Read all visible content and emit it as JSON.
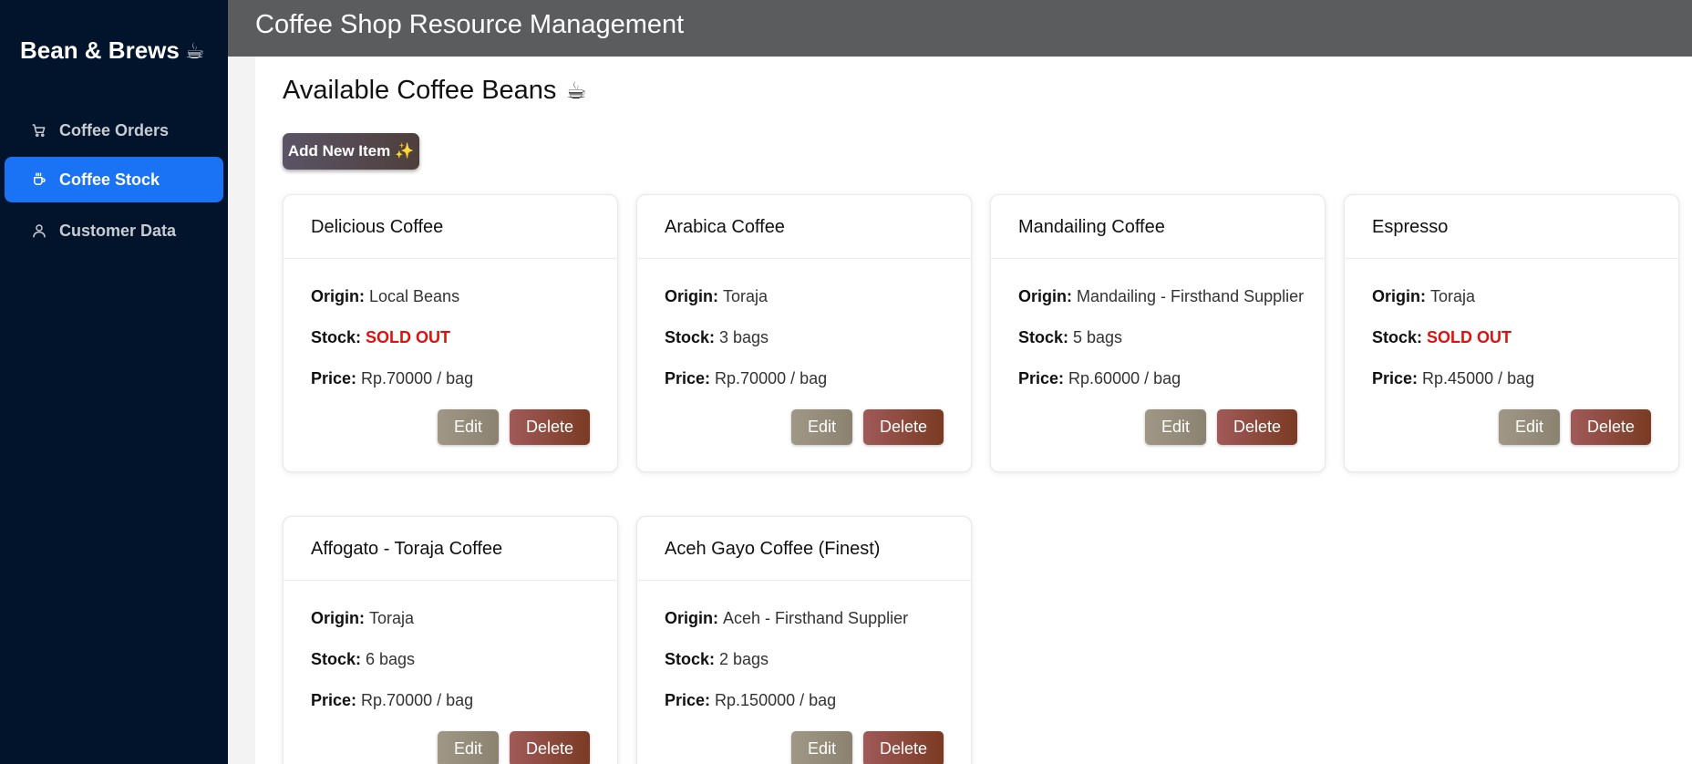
{
  "sidebar": {
    "brand": "Bean & Brews",
    "brand_icon": "☕",
    "items": [
      {
        "label": "Coffee Orders",
        "icon": "cart-icon",
        "active": false
      },
      {
        "label": "Coffee Stock",
        "icon": "cup-icon",
        "active": true
      },
      {
        "label": "Customer Data",
        "icon": "user-icon",
        "active": false
      }
    ]
  },
  "header": {
    "title": "Coffee Shop Resource Management"
  },
  "main": {
    "title": "Available Coffee Beans",
    "title_icon": "☕",
    "add_button": "Add New Item ✨"
  },
  "labels": {
    "origin": "Origin:",
    "stock": "Stock:",
    "price": "Price:",
    "edit": "Edit",
    "delete": "Delete"
  },
  "products": [
    {
      "name": "Delicious Coffee",
      "origin": "Local Beans",
      "stock": "SOLD OUT",
      "sold_out": true,
      "price": "Rp.70000 / bag"
    },
    {
      "name": "Arabica Coffee",
      "origin": "Toraja",
      "stock": "3 bags",
      "sold_out": false,
      "price": "Rp.70000 / bag"
    },
    {
      "name": "Mandailing Coffee",
      "origin": "Mandailing - Firsthand Supplier",
      "stock": "5 bags",
      "sold_out": false,
      "price": "Rp.60000 / bag"
    },
    {
      "name": "Espresso",
      "origin": "Toraja",
      "stock": "SOLD OUT",
      "sold_out": true,
      "price": "Rp.45000 / bag"
    },
    {
      "name": "Affogato - Toraja Coffee",
      "origin": "Toraja",
      "stock": "6 bags",
      "sold_out": false,
      "price": "Rp.70000 / bag"
    },
    {
      "name": "Aceh Gayo Coffee (Finest)",
      "origin": "Aceh - Firsthand Supplier",
      "stock": "2 bags",
      "sold_out": false,
      "price": "Rp.150000 / bag"
    }
  ],
  "colors": {
    "sidebar_bg": "#02142b",
    "active_nav": "#1a73f5",
    "header_bg": "#5b5c5e",
    "sold_out": "#e01010",
    "edit_button": "#968c7a",
    "delete_button": "#8e4a3d"
  }
}
